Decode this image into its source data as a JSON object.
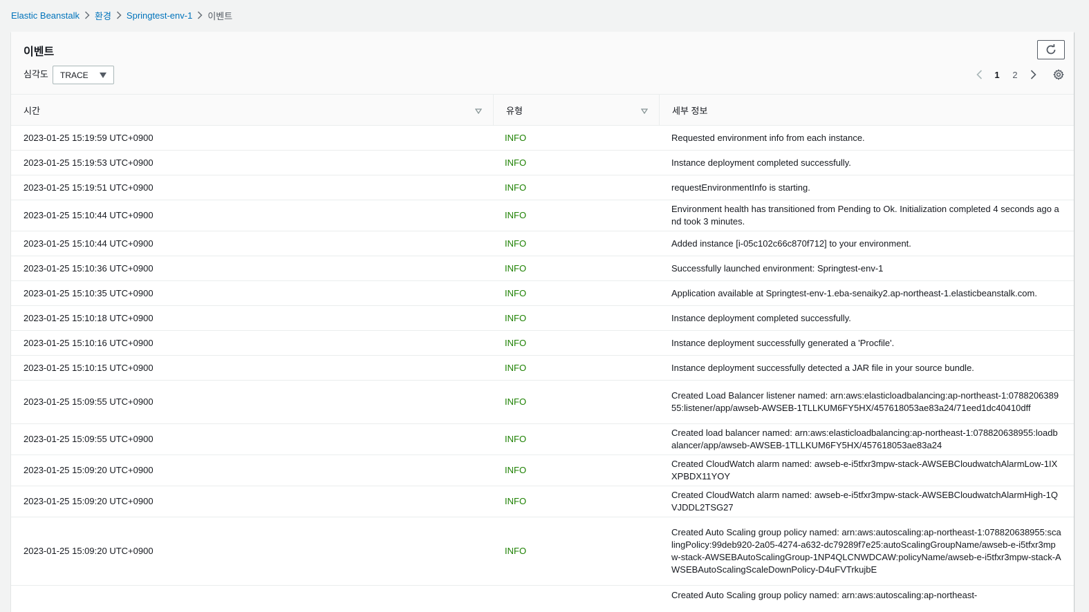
{
  "breadcrumb": {
    "items": [
      "Elastic Beanstalk",
      "환경",
      "Springtest-env-1"
    ],
    "current": "이벤트"
  },
  "panel": {
    "title": "이벤트",
    "severity_label": "심각도",
    "severity_value": "TRACE",
    "pagination": {
      "pages": [
        "1",
        "2"
      ],
      "current": "1"
    }
  },
  "table": {
    "columns": [
      "시간",
      "유형",
      "세부 정보"
    ],
    "rows": [
      {
        "time": "2023-01-25 15:19:59 UTC+0900",
        "type": "INFO",
        "detail": "Requested environment info from each instance."
      },
      {
        "time": "2023-01-25 15:19:53 UTC+0900",
        "type": "INFO",
        "detail": "Instance deployment completed successfully."
      },
      {
        "time": "2023-01-25 15:19:51 UTC+0900",
        "type": "INFO",
        "detail": "requestEnvironmentInfo is starting."
      },
      {
        "time": "2023-01-25 15:10:44 UTC+0900",
        "type": "INFO",
        "detail": "Environment health has transitioned from Pending to Ok. Initialization completed 4 seconds ago and took 3 minutes."
      },
      {
        "time": "2023-01-25 15:10:44 UTC+0900",
        "type": "INFO",
        "detail": "Added instance [i-05c102c66c870f712] to your environment."
      },
      {
        "time": "2023-01-25 15:10:36 UTC+0900",
        "type": "INFO",
        "detail": "Successfully launched environment: Springtest-env-1"
      },
      {
        "time": "2023-01-25 15:10:35 UTC+0900",
        "type": "INFO",
        "detail": "Application available at Springtest-env-1.eba-senaiky2.ap-northeast-1.elasticbeanstalk.com."
      },
      {
        "time": "2023-01-25 15:10:18 UTC+0900",
        "type": "INFO",
        "detail": "Instance deployment completed successfully."
      },
      {
        "time": "2023-01-25 15:10:16 UTC+0900",
        "type": "INFO",
        "detail": "Instance deployment successfully generated a 'Procfile'."
      },
      {
        "time": "2023-01-25 15:10:15 UTC+0900",
        "type": "INFO",
        "detail": "Instance deployment successfully detected a JAR file in your source bundle."
      },
      {
        "time": "2023-01-25 15:09:55 UTC+0900",
        "type": "INFO",
        "detail": "Created Load Balancer listener named: arn:aws:elasticloadbalancing:ap-northeast-1:078820638955:listener/app/awseb-AWSEB-1TLLKUM6FY5HX/457618053ae83a24/71eed1dc40410dff"
      },
      {
        "time": "2023-01-25 15:09:55 UTC+0900",
        "type": "INFO",
        "detail": "Created load balancer named: arn:aws:elasticloadbalancing:ap-northeast-1:078820638955:loadbalancer/app/awseb-AWSEB-1TLLKUM6FY5HX/457618053ae83a24"
      },
      {
        "time": "2023-01-25 15:09:20 UTC+0900",
        "type": "INFO",
        "detail": "Created CloudWatch alarm named: awseb-e-i5tfxr3mpw-stack-AWSEBCloudwatchAlarmLow-1IXXPBDX11YOY"
      },
      {
        "time": "2023-01-25 15:09:20 UTC+0900",
        "type": "INFO",
        "detail": "Created CloudWatch alarm named: awseb-e-i5tfxr3mpw-stack-AWSEBCloudwatchAlarmHigh-1QVJDDL2TSG27"
      },
      {
        "time": "2023-01-25 15:09:20 UTC+0900",
        "type": "INFO",
        "detail": "Created Auto Scaling group policy named: arn:aws:autoscaling:ap-northeast-1:078820638955:scalingPolicy:99deb920-2a05-4274-a632-dc79289f7e25:autoScalingGroupName/awseb-e-i5tfxr3mpw-stack-AWSEBAutoScalingGroup-1NP4QLCNWDCAW:policyName/awseb-e-i5tfxr3mpw-stack-AWSEBAutoScalingScaleDownPolicy-D4uFVTrkujbE"
      },
      {
        "time": "",
        "type": "",
        "detail": "Created Auto Scaling group policy named: arn:aws:autoscaling:ap-northeast-"
      }
    ]
  },
  "colors": {
    "accent": "#0073bb",
    "info": "#1d8102",
    "border": "#eaeded"
  },
  "icons": [
    "chevron-right-icon",
    "refresh-icon",
    "caret-down-icon",
    "chevron-left-icon",
    "settings-gear-icon",
    "sort-triangle-icon"
  ]
}
